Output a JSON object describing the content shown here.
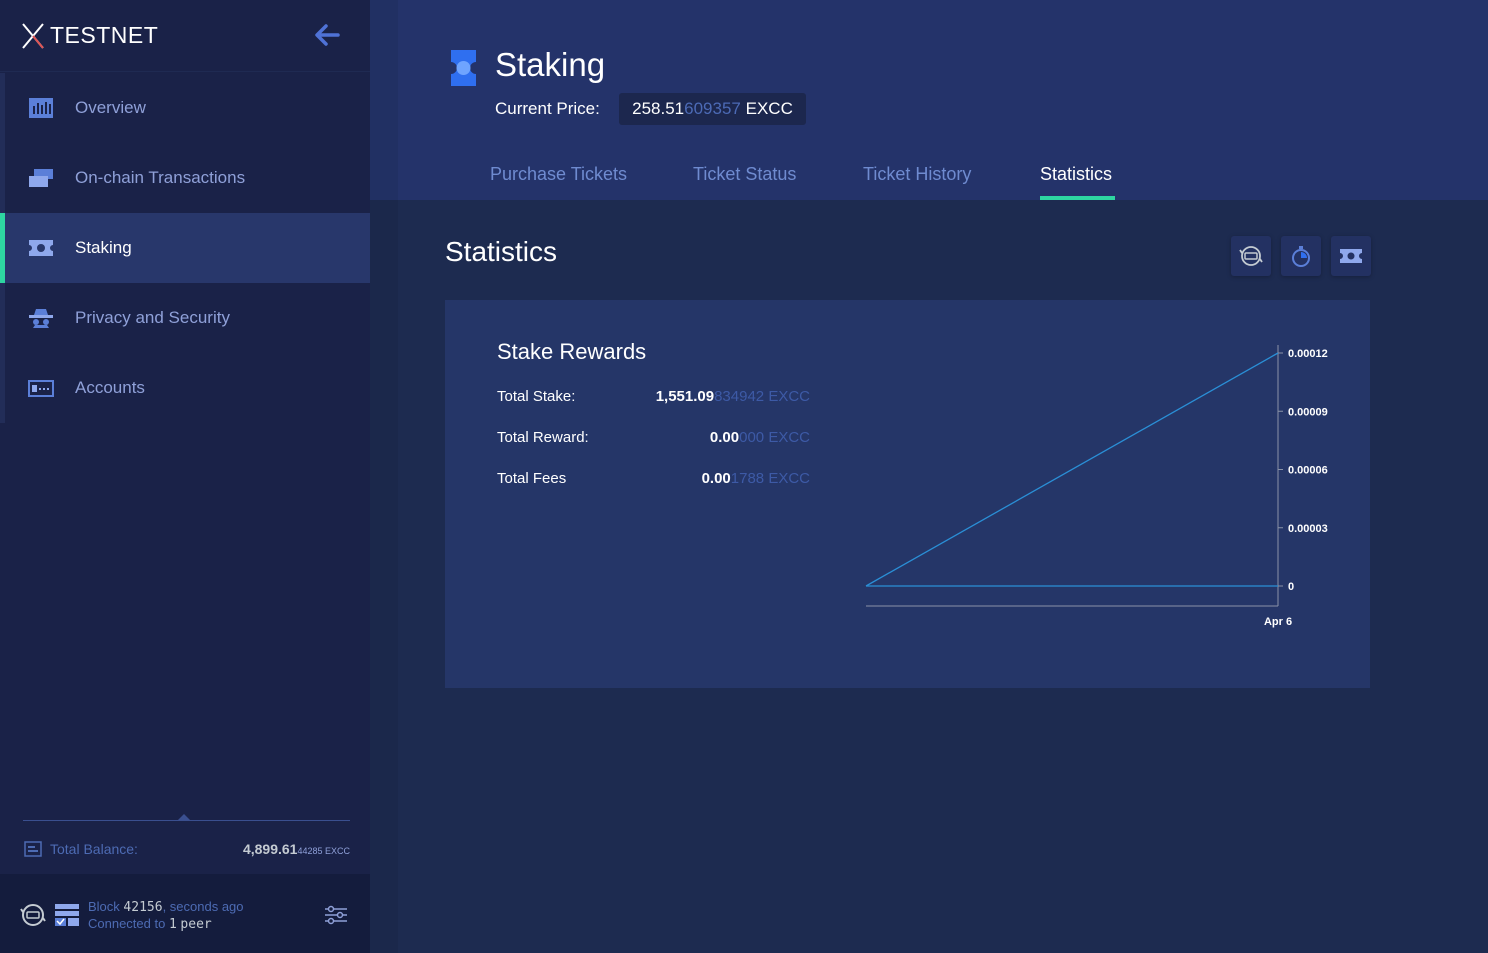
{
  "sidebar": {
    "brand": "TESTNET",
    "items": [
      {
        "label": "Overview",
        "icon": "overview-icon"
      },
      {
        "label": "On-chain Transactions",
        "icon": "transactions-icon"
      },
      {
        "label": "Staking",
        "icon": "ticket-icon",
        "active": true
      },
      {
        "label": "Privacy and Security",
        "icon": "spy-icon"
      },
      {
        "label": "Accounts",
        "icon": "accounts-icon"
      }
    ],
    "balance": {
      "label": "Total Balance:",
      "value_main": "4,899.61",
      "value_small": "44285 EXCC"
    },
    "status": {
      "block_label": "Block",
      "block_number": "42156",
      "block_suffix": ", seconds ago",
      "connected_label": "Connected to",
      "peer_count": "1",
      "peer_word": "peer"
    }
  },
  "header": {
    "title": "Staking",
    "price_label": "Current Price:",
    "price_main": "258.51",
    "price_dim": "609357",
    "price_unit": "EXCC",
    "tabs": [
      "Purchase Tickets",
      "Ticket Status",
      "Ticket History",
      "Statistics"
    ],
    "active_tab": "Statistics"
  },
  "main": {
    "section_title": "Statistics",
    "panel_title": "Stake Rewards",
    "stats": [
      {
        "label": "Total Stake:",
        "main": "1,551.09",
        "dim": "834942 EXCC"
      },
      {
        "label": "Total Reward:",
        "main": "0.00",
        "dim": "000 EXCC"
      },
      {
        "label": "Total Fees",
        "main": "0.00",
        "dim": "1788 EXCC"
      }
    ]
  },
  "chart_data": {
    "type": "line",
    "x": [
      "Apr 6"
    ],
    "y_ticks": [
      "0",
      "0.00003",
      "0.00006",
      "0.00009",
      "0.00012"
    ],
    "ylim": [
      0,
      0.00012
    ],
    "series": [
      {
        "values": [
          0,
          0.00012
        ]
      },
      {
        "values": [
          0,
          0
        ]
      }
    ],
    "colors": {
      "line": "#2a8fd6",
      "axis": "#8a93a8"
    }
  },
  "colors": {
    "accent": "#2ed6a1",
    "sidebar_bg": "#1a2248",
    "header_bg": "#24336a",
    "panel_bg": "#253668"
  }
}
